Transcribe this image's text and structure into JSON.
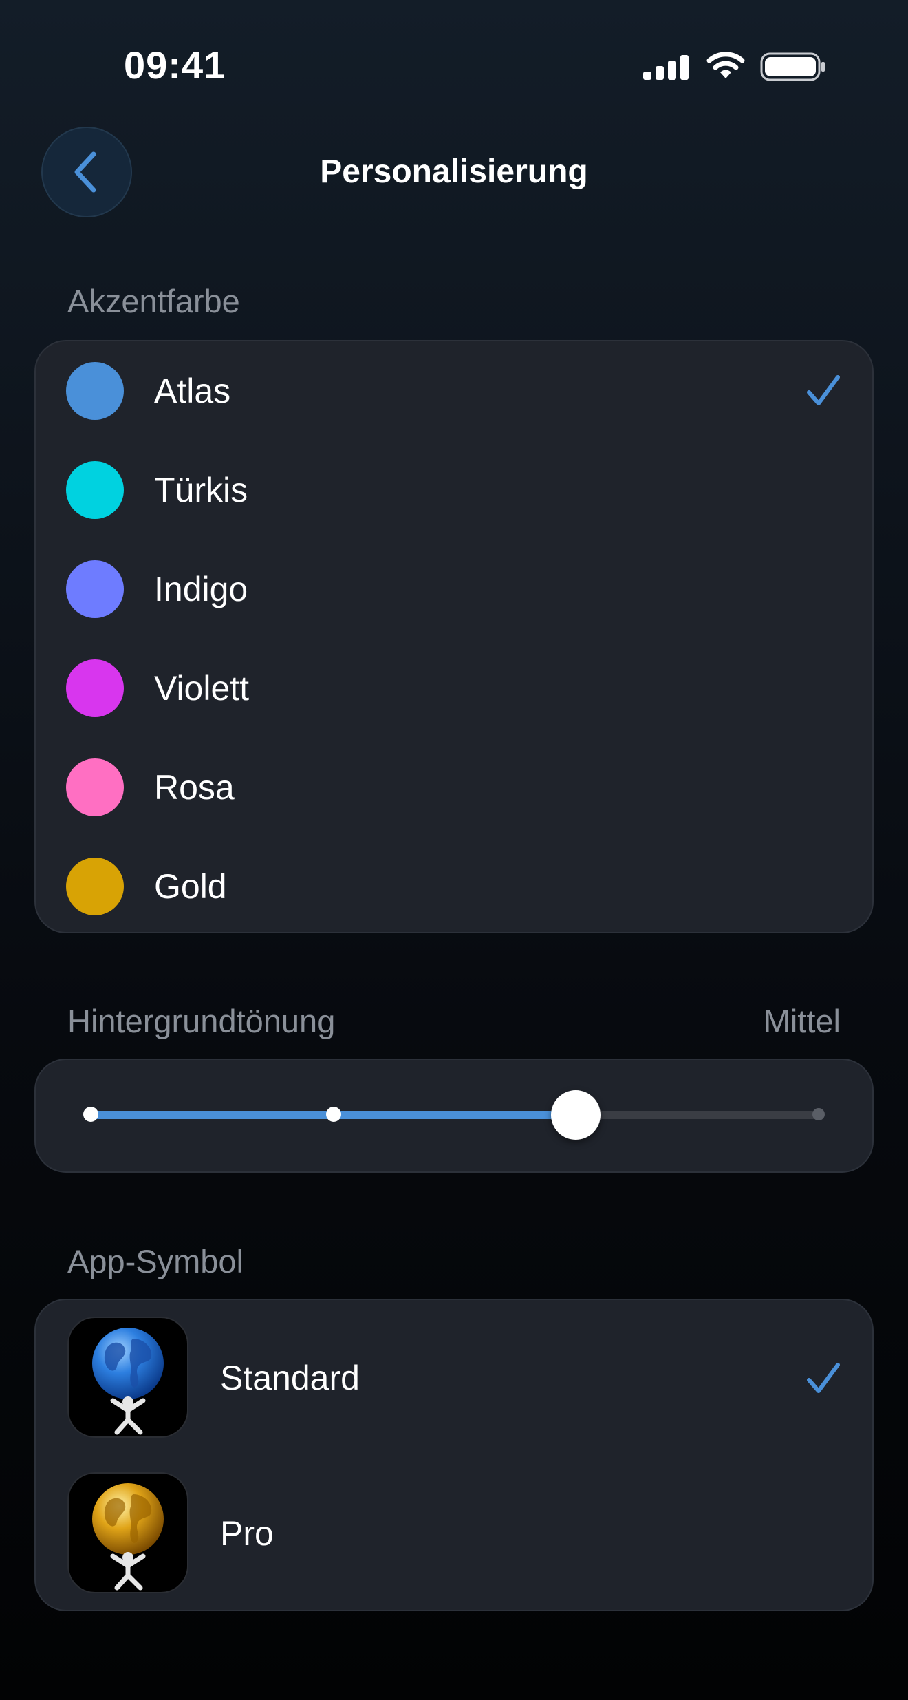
{
  "status_bar": {
    "time": "09:41"
  },
  "nav": {
    "title": "Personalisierung",
    "back_icon": "chevron-left-icon"
  },
  "accent": {
    "section_label": "Akzentfarbe",
    "selected": "Atlas",
    "options": [
      {
        "label": "Atlas",
        "color": "#4a90d9",
        "selected": true
      },
      {
        "label": "Türkis",
        "color": "#00d2e0",
        "selected": false
      },
      {
        "label": "Indigo",
        "color": "#6e7cff",
        "selected": false
      },
      {
        "label": "Violett",
        "color": "#d836ee",
        "selected": false
      },
      {
        "label": "Rosa",
        "color": "#ff6fc2",
        "selected": false
      },
      {
        "label": "Gold",
        "color": "#d8a305",
        "selected": false
      }
    ]
  },
  "tint": {
    "section_label": "Hintergrundtönung",
    "value_label": "Mittel",
    "steps": 4,
    "selected_index": 2,
    "fill_color": "#4a90d9"
  },
  "app_icon": {
    "section_label": "App-Symbol",
    "options": [
      {
        "label": "Standard",
        "globe": "blue",
        "selected": true
      },
      {
        "label": "Pro",
        "globe": "gold",
        "selected": false
      }
    ]
  },
  "colors": {
    "accent": "#4a90d9",
    "card": "#1f232b",
    "secondary_text": "#8a9099"
  }
}
